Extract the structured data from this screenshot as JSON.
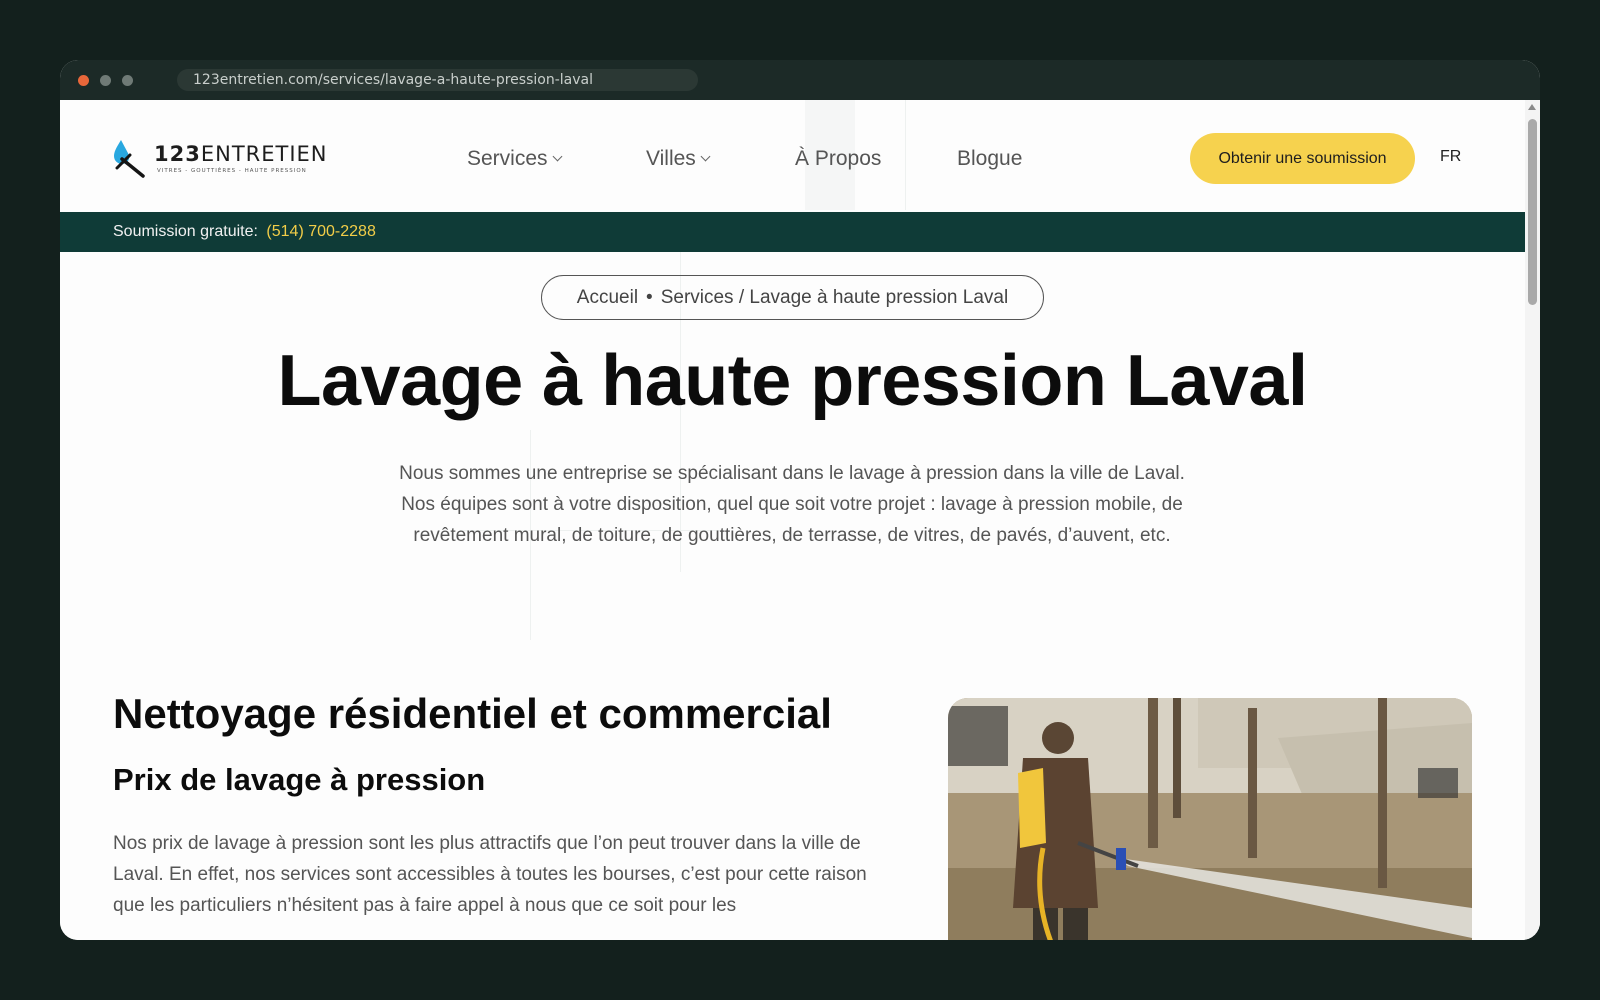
{
  "browser": {
    "url": "123entretien.com/services/lavage-a-haute-pression-laval"
  },
  "logo": {
    "name_bold": "123",
    "name_rest": "ENTRETIEN",
    "tagline": "VITRES - GOUTTIÈRES - HAUTE PRESSION"
  },
  "nav": {
    "services": "Services",
    "villes": "Villes",
    "a_propos": "À Propos",
    "blogue": "Blogue"
  },
  "header": {
    "cta_label": "Obtenir une soumission",
    "language": "FR"
  },
  "topbar": {
    "label": "Soumission gratuite:",
    "phone": "(514) 700-2288"
  },
  "breadcrumb": {
    "home": "Accueil",
    "separator": "•",
    "path": "Services / Lavage à haute pression Laval"
  },
  "hero": {
    "title": "Lavage à haute pression Laval",
    "description": "Nous sommes une entreprise se spécialisant dans le lavage à pression dans la ville de Laval. Nos équipes sont à votre disposition, quel que soit votre projet : lavage à pression mobile, de revêtement mural, de toiture, de gouttières, de terrasse, de vitres, de pavés, d’auvent, etc."
  },
  "section": {
    "title": "Nettoyage résidentiel et commercial",
    "subtitle": "Prix de lavage à pression",
    "text": "Nos prix de lavage à pression sont les plus attractifs que l’on peut trouver dans la ville de Laval. En effet, nos services sont accessibles à toutes les bourses, c’est pour cette raison que les particuliers n’hésitent pas à faire appel à nous que ce soit pour les"
  },
  "colors": {
    "accent": "#f6d24e",
    "topbar_bg": "#0f3b37",
    "phone": "#f2cd48",
    "logo_blue": "#29a8e0"
  },
  "icons": {
    "logo": "squeegee-droplet-icon",
    "dropdown": "chevron-down-icon"
  }
}
